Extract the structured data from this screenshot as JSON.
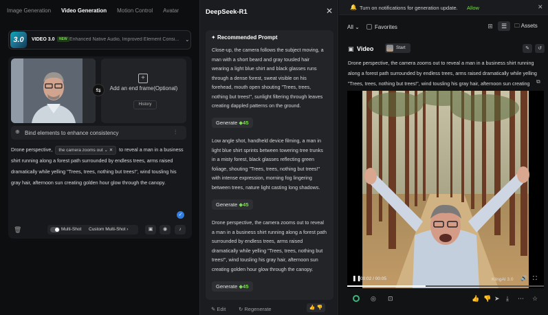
{
  "left": {
    "tabs": [
      "Image Generation",
      "Video Generation",
      "Motion Control",
      "Avatar"
    ],
    "active_tab": "Video Generation",
    "model": {
      "logo_text": "3.0",
      "name": "VIDEO 3.0",
      "badge": "NEW",
      "description": "Enhanced Native Audio, Improved Element Consi..."
    },
    "end_frame": {
      "label": "Add an end frame(Optional)",
      "history_label": "History"
    },
    "bind_label": "Bind elements to enhance consistency",
    "prompt": {
      "before": "Drone perspective,",
      "chip": "the camera zooms out",
      "after": "to reveal a man in a business shirt running along a forest path surrounded by endless trees, arms raised dramatically while yelling \"Trees, trees, nothing but trees!\", wind tousling his gray hair, afternoon sun creating golden hour glow through the canopy."
    },
    "multi_shot_label": "Multi-Shot",
    "custom_multi_shot_label": "Custom Multi-Shot"
  },
  "mid": {
    "title": "DeepSeek-R1",
    "section_title": "Recommended Prompt",
    "prompts": [
      "Close-up, the camera follows the subject moving, a man with a short beard and gray tousled hair wearing a light blue shirt and black glasses runs through a dense forest, sweat visible on his forehead, mouth open shouting \"Trees, trees, nothing but trees!\", sunlight filtering through leaves creating dappled patterns on the ground.",
      "Low angle shot, handheld device filming, a man in light blue shirt sprints between towering tree trunks in a misty forest, black glasses reflecting green foliage, shouting \"Trees, trees, nothing but trees!\" with intense expression, morning fog lingering between trees, nature light casting long shadows.",
      "Drone perspective, the camera zooms out to reveal a man in a business shirt running along a forest path surrounded by endless trees, arms raised dramatically while yelling \"Trees, trees, nothing but trees!\", wind tousling his gray hair, afternoon sun creating golden hour glow through the canopy."
    ],
    "generate_label": "Generate",
    "generate_cost": "45",
    "edit_label": "Edit",
    "regenerate_label": "Regenerate"
  },
  "right": {
    "notification": "Turn on notifications for generation update.",
    "allow_label": "Allow",
    "filter_label": "All",
    "favorites_label": "Favorites",
    "assets_label": "Assets",
    "video_title": "Video",
    "start_label": "Start",
    "prompt": "Drone perspective,  the camera zooms out to reveal a man in a business shirt running along a forest path surrounded by endless trees, arms raised dramatically while yelling \"Trees, trees, nothing but trees!\", wind tousling his gray hair, afternoon sun creating golden hour glow through the canopy.",
    "player": {
      "time": "00:02 / 00:05",
      "progress": 0.4,
      "watermark": "KlingAI 3.0"
    }
  },
  "colors": {
    "accent_green": "#7ed957",
    "accent_blue": "#2f7de1",
    "panel_bg": "#17181b"
  },
  "icons": [
    "search-icon",
    "swap-icon",
    "bind-icon",
    "trash-icon",
    "bell-icon",
    "grid-icon",
    "list-icon",
    "folder-icon",
    "play-icon",
    "volume-icon",
    "fullscreen-icon"
  ]
}
